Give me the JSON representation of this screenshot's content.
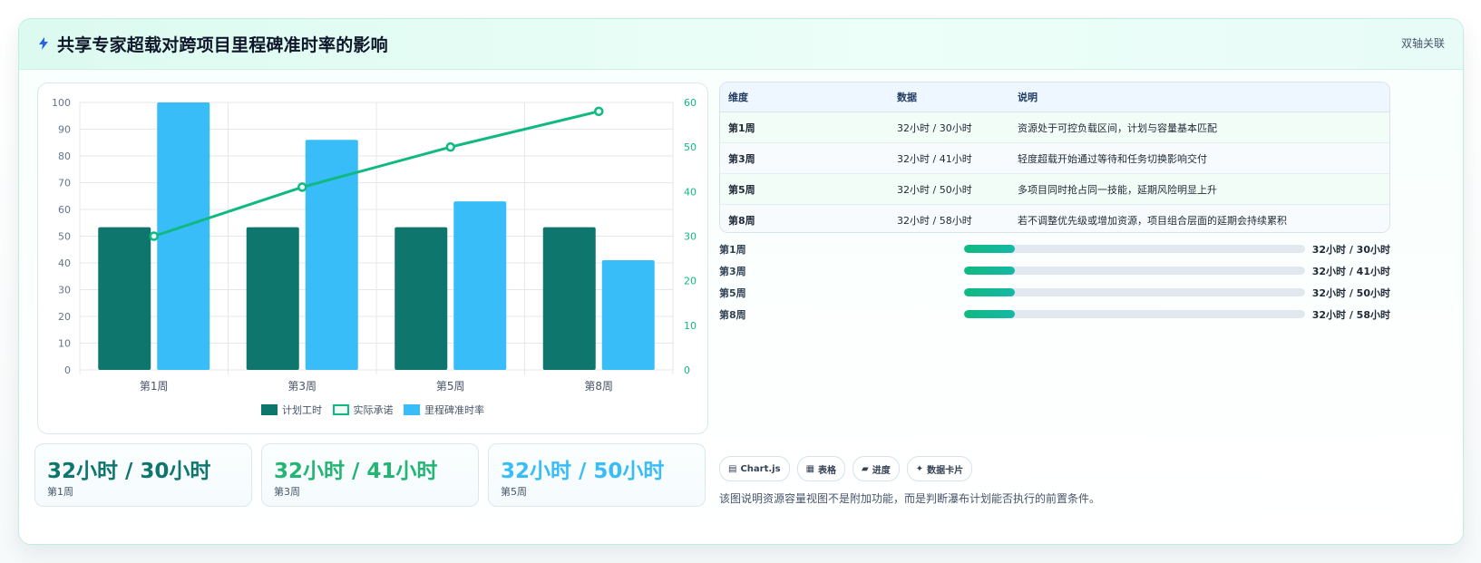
{
  "header": {
    "title": "共享专家超载对跨项目里程碑准时率的影响",
    "tag": "双轴关联"
  },
  "colors": {
    "planned": "#0f766e",
    "committed": "#10b981",
    "ontime": "#38bdf8",
    "accent_green": "#22b573",
    "accent_blue": "#38bdf8"
  },
  "chart_data": {
    "type": "bar",
    "categories": [
      "第1周",
      "第3周",
      "第5周",
      "第8周"
    ],
    "series": [
      {
        "name": "计划工时",
        "type": "bar",
        "axis": "right",
        "values": [
          32,
          32,
          32,
          32
        ]
      },
      {
        "name": "实际承诺",
        "type": "line",
        "axis": "right",
        "values": [
          30,
          41,
          50,
          58
        ]
      },
      {
        "name": "里程碑准时率",
        "type": "bar",
        "axis": "left",
        "values": [
          100,
          86,
          63,
          41
        ]
      }
    ],
    "left_axis": {
      "ylim": [
        0,
        100
      ],
      "ticks": [
        0,
        10,
        20,
        30,
        40,
        50,
        60,
        70,
        80,
        90,
        100
      ]
    },
    "right_axis": {
      "ylim": [
        0,
        60
      ],
      "ticks": [
        0,
        10,
        20,
        30,
        40,
        50,
        60
      ]
    },
    "grid": true,
    "legend_position": "bottom"
  },
  "kpis": [
    {
      "value": "32小时 / 30小时",
      "label": "第1周",
      "color": "#0f766e"
    },
    {
      "value": "32小时 / 41小时",
      "label": "第3周",
      "color": "#22b573"
    },
    {
      "value": "32小时 / 50小时",
      "label": "第5周",
      "color": "#38bdf8"
    }
  ],
  "table": {
    "headers": [
      "维度",
      "数据",
      "说明"
    ],
    "rows": [
      [
        "第1周",
        "32小时 / 30小时",
        "资源处于可控负载区间，计划与容量基本匹配"
      ],
      [
        "第3周",
        "32小时 / 41小时",
        "轻度超载开始通过等待和任务切换影响交付"
      ],
      [
        "第5周",
        "32小时 / 50小时",
        "多项目同时抢占同一技能，延期风险明显上升"
      ],
      [
        "第8周",
        "32小时 / 58小时",
        "若不调整优先级或增加资源，项目组合层面的延期会持续累积"
      ]
    ]
  },
  "progress": [
    {
      "label": "第1周",
      "value": "32小时 / 30小时",
      "fraction": 0.15
    },
    {
      "label": "第3周",
      "value": "32小时 / 41小时",
      "fraction": 0.15
    },
    {
      "label": "第5周",
      "value": "32小时 / 50小时",
      "fraction": 0.15
    },
    {
      "label": "第8周",
      "value": "32小时 / 58小时",
      "fraction": 0.15
    }
  ],
  "chips": [
    {
      "glyph": "▤",
      "label": "Chart.js"
    },
    {
      "glyph": "▦",
      "label": "表格"
    },
    {
      "glyph": "▰",
      "label": "进度"
    },
    {
      "glyph": "✦",
      "label": "数据卡片"
    }
  ],
  "footnote": "该图说明资源容量视图不是附加功能，而是判断瀑布计划能否执行的前置条件。",
  "icons": {
    "header": "lightning-icon"
  }
}
